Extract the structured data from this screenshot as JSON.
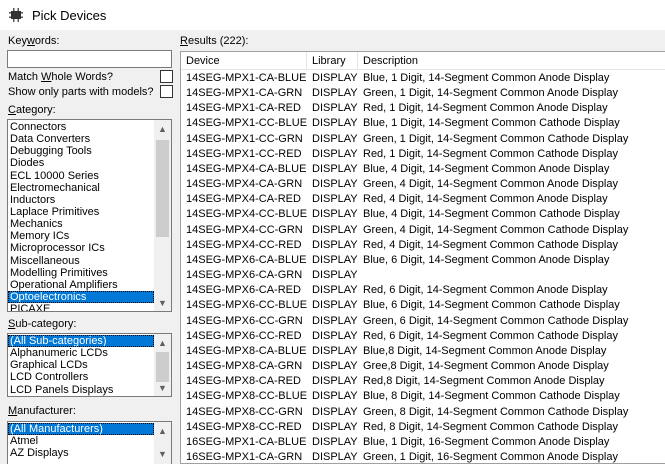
{
  "window": {
    "title": "Pick Devices"
  },
  "keywords": {
    "label_pre": "Key",
    "label_u": "w",
    "label_post": "ords:",
    "value": ""
  },
  "options": {
    "match_pre": "Match ",
    "match_u": "W",
    "match_post": "hole Words?",
    "show_only": "Show only parts with models?"
  },
  "category": {
    "label_u": "C",
    "label_post": "ategory:",
    "items": [
      "Connectors",
      "Data Converters",
      "Debugging Tools",
      "Diodes",
      "ECL 10000 Series",
      "Electromechanical",
      "Inductors",
      "Laplace Primitives",
      "Mechanics",
      "Memory ICs",
      "Microprocessor ICs",
      "Miscellaneous",
      "Modelling Primitives",
      "Operational Amplifiers",
      "Optoelectronics",
      "PICAXE"
    ],
    "selected": "Optoelectronics"
  },
  "subcategory": {
    "label_u": "S",
    "label_post": "ub-category:",
    "items": [
      "(All Sub-categories)",
      "Alphanumeric LCDs",
      "Graphical LCDs",
      "LCD Controllers",
      "LCD Panels Displays"
    ],
    "selected": "(All Sub-categories)"
  },
  "manufacturer": {
    "label_u": "M",
    "label_post": "anufacturer:",
    "items": [
      "(All Manufacturers)",
      "Atmel",
      "AZ Displays"
    ],
    "selected": "(All Manufacturers)"
  },
  "results": {
    "label_u": "R",
    "label_post": "esults (222):",
    "columns": [
      "Device",
      "Library",
      "Description"
    ],
    "rows": [
      [
        "14SEG-MPX1-CA-BLUE",
        "DISPLAY",
        "Blue, 1 Digit, 14-Segment Common Anode Display"
      ],
      [
        "14SEG-MPX1-CA-GRN",
        "DISPLAY",
        "Green, 1 Digit, 14-Segment Common Anode Display"
      ],
      [
        "14SEG-MPX1-CA-RED",
        "DISPLAY",
        "Red, 1 Digit, 14-Segment Common Anode Display"
      ],
      [
        "14SEG-MPX1-CC-BLUE",
        "DISPLAY",
        "Blue, 1 Digit, 14-Segment Common Cathode Display"
      ],
      [
        "14SEG-MPX1-CC-GRN",
        "DISPLAY",
        "Green, 1 Digit, 14-Segment Common Cathode Display"
      ],
      [
        "14SEG-MPX1-CC-RED",
        "DISPLAY",
        "Red, 1 Digit, 14-Segment Common Cathode Display"
      ],
      [
        "14SEG-MPX4-CA-BLUE",
        "DISPLAY",
        "Blue, 4 Digit, 14-Segment Common Anode Display"
      ],
      [
        "14SEG-MPX4-CA-GRN",
        "DISPLAY",
        "Green, 4 Digit, 14-Segment Common Anode Display"
      ],
      [
        "14SEG-MPX4-CA-RED",
        "DISPLAY",
        "Red, 4 Digit, 14-Segment Common Anode Display"
      ],
      [
        "14SEG-MPX4-CC-BLUE",
        "DISPLAY",
        "Blue, 4 Digit, 14-Segment Common Cathode Display"
      ],
      [
        "14SEG-MPX4-CC-GRN",
        "DISPLAY",
        "Green, 4 Digit, 14-Segment Common Cathode Display"
      ],
      [
        "14SEG-MPX4-CC-RED",
        "DISPLAY",
        "Red, 4 Digit, 14-Segment Common Cathode Display"
      ],
      [
        "14SEG-MPX6-CA-BLUE",
        "DISPLAY",
        "Blue, 6 Digit, 14-Segment Common Anode Display"
      ],
      [
        "14SEG-MPX6-CA-GRN",
        "DISPLAY",
        ""
      ],
      [
        "14SEG-MPX6-CA-RED",
        "DISPLAY",
        "Red, 6 Digit, 14-Segment Common Anode Display"
      ],
      [
        "14SEG-MPX6-CC-BLUE",
        "DISPLAY",
        "Blue, 6 Digit, 14-Segment Common Cathode Display"
      ],
      [
        "14SEG-MPX6-CC-GRN",
        "DISPLAY",
        "Green, 6 Digit, 14-Segment Common Cathode Display"
      ],
      [
        "14SEG-MPX6-CC-RED",
        "DISPLAY",
        "Red, 6 Digit, 14-Segment Common Cathode Display"
      ],
      [
        "14SEG-MPX8-CA-BLUE",
        "DISPLAY",
        "Blue,8 Digit, 14-Segment Common Anode Display"
      ],
      [
        "14SEG-MPX8-CA-GRN",
        "DISPLAY",
        "Gree,8 Digit, 14-Segment Common Anode Display"
      ],
      [
        "14SEG-MPX8-CA-RED",
        "DISPLAY",
        "Red,8 Digit, 14-Segment Common Anode Display"
      ],
      [
        "14SEG-MPX8-CC-BLUE",
        "DISPLAY",
        "Blue, 8 Digit, 14-Segment Common Cathode Display"
      ],
      [
        "14SEG-MPX8-CC-GRN",
        "DISPLAY",
        "Green, 8 Digit, 14-Segment Common Cathode Display"
      ],
      [
        "14SEG-MPX8-CC-RED",
        "DISPLAY",
        "Red, 8 Digit, 14-Segment Common Cathode Display"
      ],
      [
        "16SEG-MPX1-CA-BLUE",
        "DISPLAY",
        "Blue, 1 Digit, 16-Segment Common Anode Display"
      ],
      [
        "16SEG-MPX1-CA-GRN",
        "DISPLAY",
        "Green, 1 Digit, 16-Segment Common Anode Display"
      ]
    ]
  },
  "icons": {
    "app": "pick-devices-icon",
    "scroll_up": "scroll-up-icon",
    "scroll_down": "scroll-down-icon"
  },
  "colors": {
    "selection": "#0078d7",
    "window_bg": "#f0f0f0",
    "list_bg": "#ffffff"
  }
}
